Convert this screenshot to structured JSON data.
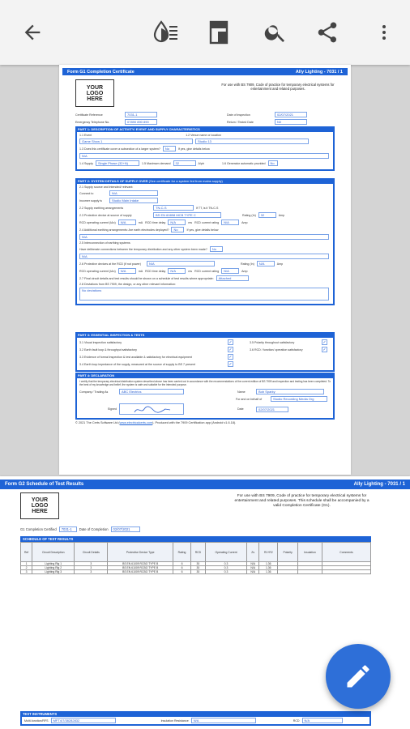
{
  "toolbar": {
    "back_icon": "arrow-back-icon",
    "icons": [
      "theme-icon",
      "page-layout-icon",
      "search-icon",
      "share-icon",
      "more-vert-icon"
    ]
  },
  "page1": {
    "header_title": "Form G1 Completion Certificate",
    "header_right": "Ally Lighting - 7031 / 1",
    "logo_lines": [
      "YOUR",
      "LOGO",
      "HERE"
    ],
    "intro": "For use with BS 7909, Code of practice for temporary electrical systems for entertainment and related purposes.",
    "cert_ref_label": "Certificate Reference",
    "cert_ref_value": "7031-1",
    "emergency_label": "Emergency Telephone No.",
    "emergency_value": "07890 890 890",
    "date_label": "Date of inspection",
    "date_value": "02/07/2021",
    "return_label": "Return / Tested Date",
    "return_value": "Nil",
    "part1_title": "PART 1: DESCRIPTION OF ACTIVITY/ EVENT AND SUPPLY CHARACTERISTICS",
    "event_label": "1.1 Event",
    "event_value": "Game Show 1",
    "venue_label": "1.2 Venue name or location",
    "venue_value": "Studio 13",
    "subsection_label": "1.3 Does this certificate cover a subsection of a larger system?",
    "subsection_value": "No",
    "subsection_hint": "If yes, give details below",
    "subsection_detail": "N/A",
    "supply_label": "1.4 Supply",
    "supply_value": "Single Phase (32+N)",
    "max_demand_label": "1.5 Maximum demand",
    "max_demand_value": "32",
    "max_demand_unit": "A/ph",
    "generator_label": "1.6 Generator automatic provided",
    "generator_value": "No",
    "part2_title": "PART 2: SYSTEM DETAILS OF SUPPLY OVER",
    "part2_sub": "(See certificate for a system fed from mains supply)",
    "supply_info_label": "2.1 Supply source and intended/ relevant:",
    "connect_label": "Connect to",
    "connect_value": "N/A",
    "incomer_label": "Incomer supply is",
    "incomer_value": "Studio Main Intake",
    "earthing_label": "2.2 Supply earthing arrangements",
    "earthing_value": "TN-C-S",
    "earthing_hint": "If TT, is it TN-C-S",
    "protective_label": "2.3 Protective device at source of supply",
    "protective_value": "BS EN 60898 MCB TYPE C",
    "rating_label": "Rating (In)",
    "rating_value": "32",
    "rating_unit": "Amp",
    "rcd_label": "RCD operating current (IΔn)",
    "rcd_value": "N/A",
    "rcd_unit": "mA",
    "time_label": "RCD time delay",
    "time_value": "N/A",
    "time_unit": "ms",
    "rcd_rating_label": "RCD current rating",
    "rcd_rating_value": "N/A",
    "rcd_rating_unit": "Amp",
    "additional_label": "2.4 Additional earthing arrangements: Are earth electrodes deployed?",
    "additional_value": "No",
    "additional_hint": "If yes, give details below",
    "additional_detail": "N/A",
    "interconnection_label": "2.5 Interconnection of earthing systems",
    "interconnection_q": "Have deliberate connections between the temporary distribution and any other system been made?",
    "interconnection_value": "No",
    "interconnection_detail": "N/A",
    "devices_label": "2.6 Protective devices at the RCD (if not power)",
    "devices_value": "N/A",
    "devices_rating_value": "N/A",
    "devices_rcd_value": "N/A",
    "devices_time_value": "N/A",
    "devices_rcd_rating_value": "N/A",
    "results_label": "2.7 Final circuit details and test results should be shown on a schedule of test results where appropriate:",
    "results_value": "Attached",
    "deviations_label": "2.8 Deviations from BS 7909, the design, or any other relevant information:",
    "deviations_value": "No deviations",
    "part3_title": "PART 3: ESSENTIAL INSPECTION & TESTS",
    "tests": [
      "3.1 Visual inspection satisfactory",
      "3.2 Earth fault loop & throughput satisfactory",
      "3.3 Evidence of formal inspection & test available & satisfactory for electrical equipment",
      "3.4 Earth loop impedance of the supply, measured at the source of supply to BS 7 present"
    ],
    "tests_right": [
      "3.5 Polarity throughout satisfactory",
      "3.6 RCD / function/ operation satisfactory"
    ],
    "part4_title": "PART 4: DECLARATION",
    "declaration_text": "I certify that the temporary electrical distribution system described above has been carried out in accordance with the recommendations of the current edition of BS 7909 and inspection and testing has been completed. To the best of my knowledge and belief, the system is safe and suitable for the intended purpose.",
    "company_label": "Company / Trading As",
    "company_value": "ABC Electrics",
    "name_label": "Name",
    "name_value": "Bob Sparky",
    "behalf_label": "For and on behalf of",
    "behalf_value": "Studio Recording Media Org",
    "signed_label": "Signed",
    "date2_label": "Date",
    "date2_value": "02/07/2021",
    "footer_text": "© 2021 The Certs Software Ltd (",
    "footer_link": "www.electricalcerts.com",
    "footer_tail": "). Produced with the 7909 Certification app (Android v1.6.18)."
  },
  "page2": {
    "header_title": "Form G2 Schedule of Test Results",
    "header_right": "Ally Lighting - 7031 / 1",
    "logo_lines": [
      "YOUR",
      "LOGO",
      "HERE"
    ],
    "intro": "For use with BS 7909, Code of practice for temporary electrical systems for entertainment and related purposes. This schedule shall be accompanied by a valid Completion Certificate (G1).",
    "cert_label": "G1 Completion Certified",
    "cert_value": "7031-1",
    "date_label": "Date of Completion",
    "date_value": "02/07/2021",
    "schedule_title": "SCHEDULE OF TEST RESULTS",
    "columns": [
      "Ref",
      "Circuit Description",
      "Circuit Details",
      "Protective Device Type",
      "Rating",
      "RCD",
      "Operating Current",
      "Zs",
      "R1+R2",
      "Polarity",
      "Insulation",
      "Comments"
    ],
    "rows": [
      [
        "1",
        "Lighting Rig 1",
        "3",
        "BS EN 61009 RCBO TYPE B",
        "6",
        "30",
        "0.3",
        "N/A",
        "1.36"
      ],
      [
        "2",
        "Lighting Rig 2",
        "3",
        "BS EN 61009 RCBO TYPE B",
        "6",
        "30",
        "0.3",
        "N/A",
        "1.36"
      ],
      [
        "3",
        "Lighting Rig 3",
        "3",
        "BS EN 61009 RCBO TYPE B",
        "6",
        "30",
        "0.3",
        "N/A",
        "1.36"
      ]
    ],
    "instruments_title": "TEST INSTRUMENTS",
    "multi_label": "Multi-function/RFS",
    "multi_value": "MFT4/7/38282832",
    "insulation_label": "Insulation Resistance",
    "insulation_value": "N/A",
    "rcd_label": "RCD",
    "rcd_value": "N/A"
  },
  "fab": {
    "icon": "edit-pencil-icon"
  }
}
